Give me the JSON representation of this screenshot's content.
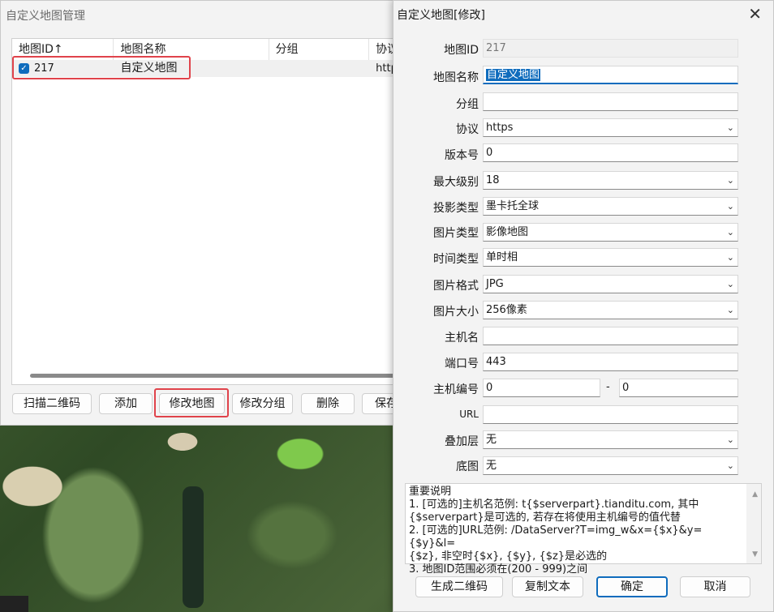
{
  "left_window": {
    "title": "自定义地图管理",
    "columns": [
      "地图ID↑",
      "地图名称",
      "分组",
      "协议"
    ],
    "rows": [
      {
        "id": "217",
        "name": "自定义地图",
        "group": "",
        "protocol": "https"
      }
    ],
    "buttons": {
      "scan": "扫描二维码",
      "add": "添加",
      "modify": "修改地图",
      "modify_group": "修改分组",
      "delete": "删除",
      "save": "保存"
    }
  },
  "dialog": {
    "title": "自定义地图[修改]",
    "close": "✕",
    "fields": {
      "map_id": {
        "label": "地图ID",
        "value": "217"
      },
      "map_name": {
        "label": "地图名称",
        "value": "自定义地图"
      },
      "group": {
        "label": "分组",
        "value": ""
      },
      "protocol": {
        "label": "协议",
        "value": "https"
      },
      "version": {
        "label": "版本号",
        "value": "0"
      },
      "max_level": {
        "label": "最大级别",
        "value": "18"
      },
      "projection": {
        "label": "投影类型",
        "value": "墨卡托全球"
      },
      "image_type": {
        "label": "图片类型",
        "value": "影像地图"
      },
      "time_type": {
        "label": "时间类型",
        "value": "单时相"
      },
      "image_format": {
        "label": "图片格式",
        "value": "JPG"
      },
      "image_size": {
        "label": "图片大小",
        "value": "256像素"
      },
      "host": {
        "label": "主机名",
        "value": ""
      },
      "port": {
        "label": "端口号",
        "value": "443"
      },
      "host_num": {
        "label": "主机编号",
        "from": "0",
        "sep": "-",
        "to": "0"
      },
      "url": {
        "label": "URL",
        "value": ""
      },
      "overlay": {
        "label": "叠加层",
        "value": "无"
      },
      "base": {
        "label": "底图",
        "value": "无"
      }
    },
    "notes": {
      "title": "重要说明",
      "line1": "1. [可选的]主机名范例: t{$serverpart}.tianditu.com, 其中",
      "line2": "{$serverpart}是可选的, 若存在将使用主机编号的值代替",
      "line3": "2. [可选的]URL范例: /DataServer?T=img_w&x={$x}&y={$y}&l=",
      "line4": "{$z}, 非空时{$x}, {$y}, {$z}是必选的",
      "line5": "3. 地图ID范围必须在(200 - 999)之间"
    },
    "buttons": {
      "gen_qr": "生成二维码",
      "copy_text": "复制文本",
      "ok": "确定",
      "cancel": "取消"
    }
  },
  "colors": {
    "accent": "#0f6cbd",
    "highlight": "#e0434b"
  }
}
